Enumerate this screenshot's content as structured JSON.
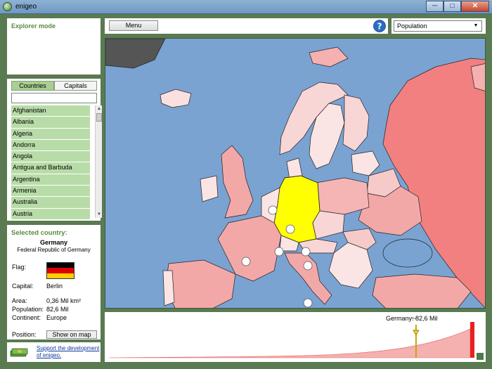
{
  "window": {
    "title": "enigeo",
    "minimize": "─",
    "maximize": "□",
    "close": "✕"
  },
  "explorer": {
    "heading": "Explorer mode"
  },
  "tabs": [
    {
      "label": "Countries",
      "active": true
    },
    {
      "label": "Capitals",
      "active": false
    }
  ],
  "search": {
    "value": "",
    "placeholder": ""
  },
  "countries": [
    "Afghanistan",
    "Albania",
    "Algeria",
    "Andorra",
    "Angola",
    "Antigua and Barbuda",
    "Argentina",
    "Armenia",
    "Australia",
    "Austria"
  ],
  "selected": {
    "heading": "Selected country:",
    "name": "Germany",
    "full_name": "Federal Republic of Germany",
    "flag_label": "Flag:",
    "flag_colors": [
      "#000000",
      "#dd0000",
      "#ffce00"
    ],
    "capital_label": "Capital:",
    "capital": "Berlin",
    "area_label": "Area:",
    "area": "0,36 Mil km²",
    "population_label": "Population:",
    "population": "82,6 Mil",
    "continent_label": "Continent:",
    "continent": "Europe",
    "position_label": "Position:",
    "show_on_map": "Show on map"
  },
  "support": {
    "link_text": "Support the development of enigeo."
  },
  "toolbar": {
    "menu_label": "Menu",
    "help_icon": "question-circle-icon"
  },
  "statistic": {
    "selected": "Population"
  },
  "chart": {
    "marker_label": "Germany: 82,6 Mil",
    "marker_position": 0.85
  },
  "colors": {
    "accent": "#5a8a3e",
    "list_item": "#b8dca8",
    "highlight": "#ffff00",
    "sea": "#7aa3d2",
    "land_high": "#f28080",
    "land_low": "#f9d6d6"
  }
}
